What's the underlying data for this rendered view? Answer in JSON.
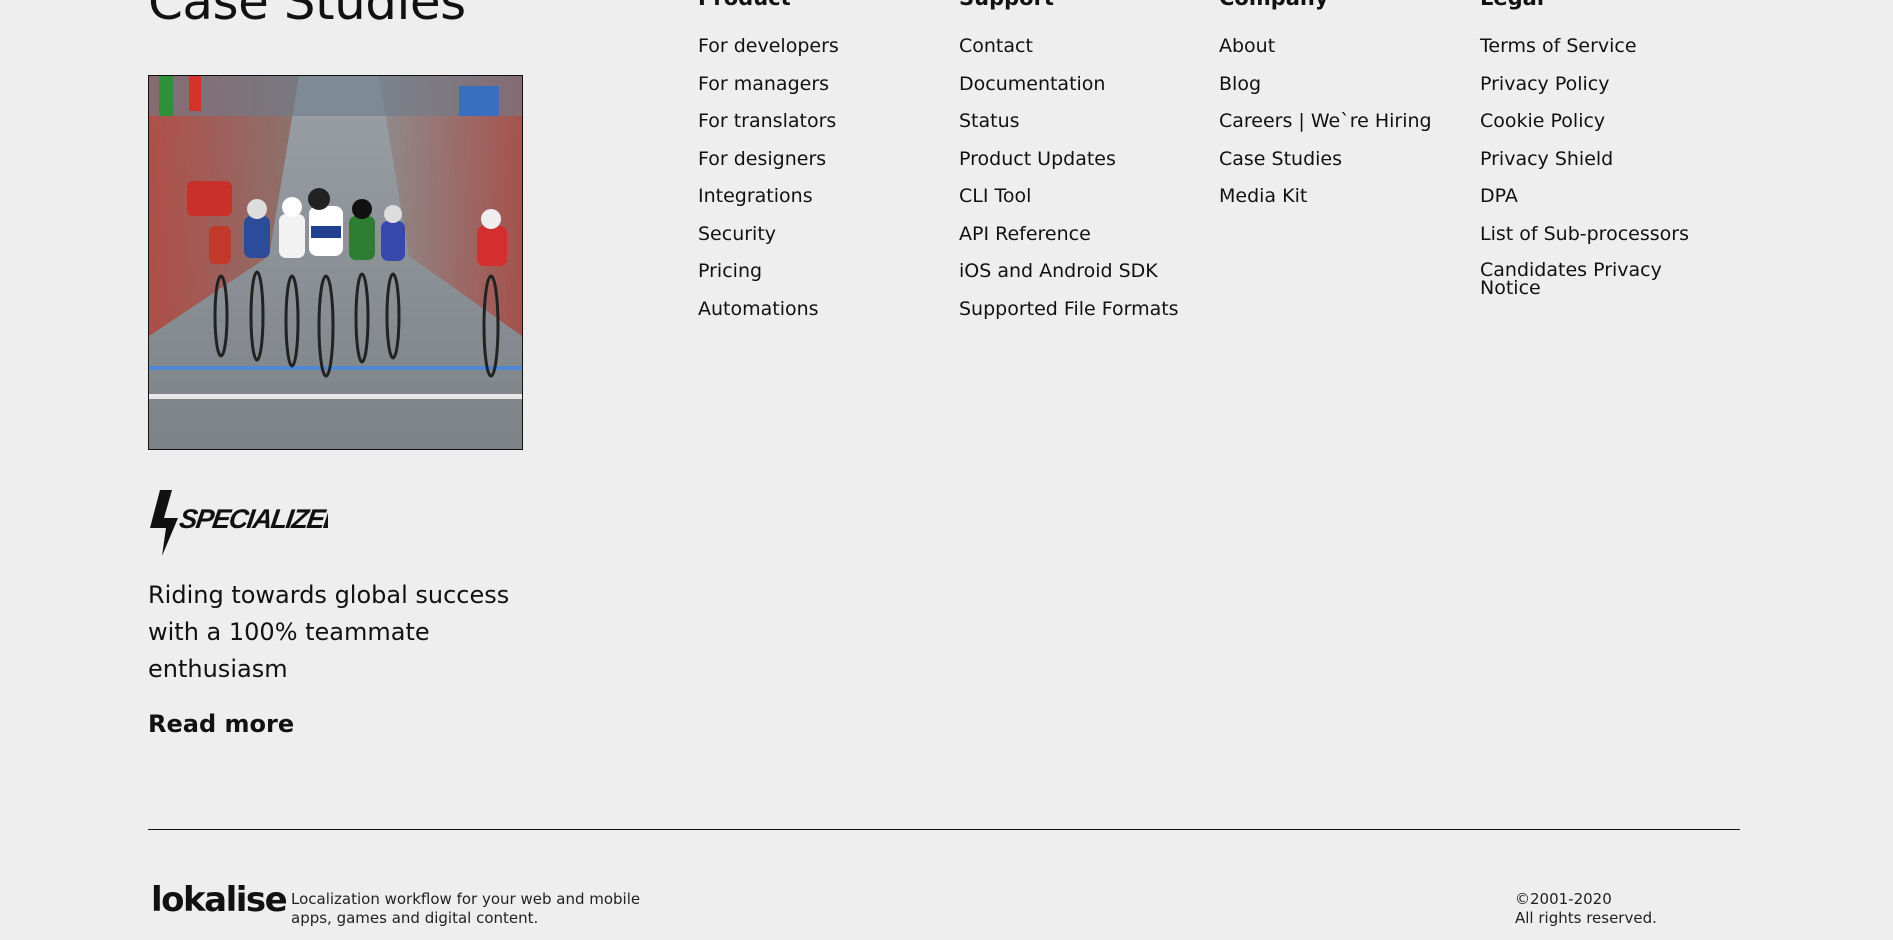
{
  "case_studies": {
    "title": "Case Studies",
    "photo_alt": "Cyclists racing toward the finish line",
    "brand_logo_text": "SPECIALIZED",
    "description": "Riding towards global success with a 100% teammate enthusiasm",
    "read_more": "Read more"
  },
  "footer_nav": {
    "product": {
      "heading": "Product",
      "items": [
        "For developers",
        "For managers",
        "For translators",
        "For designers",
        "Integrations",
        "Security",
        "Pricing",
        "Automations"
      ]
    },
    "support": {
      "heading": "Support",
      "items": [
        "Contact",
        "Documentation",
        "Status",
        "Product Updates",
        "CLI Tool",
        "API Reference",
        "iOS and Android SDK",
        "Supported File Formats"
      ]
    },
    "company": {
      "heading": "Company",
      "items": [
        "About",
        "Blog",
        "Careers | We`re Hiring",
        "Case Studies",
        "Media Kit"
      ]
    },
    "legal": {
      "heading": "Legal",
      "items": [
        "Terms of Service",
        "Privacy Policy",
        "Cookie Policy",
        "Privacy Shield",
        "DPA",
        "List of Sub-processors",
        "Candidates Privacy Notice"
      ]
    }
  },
  "footer": {
    "logo": "lokalise",
    "tagline_line1": "Localization workflow for your web and mobile",
    "tagline_line2": "apps, games and digital content.",
    "copyright_line1": "©2001-2020",
    "copyright_line2": "All rights reserved."
  },
  "colors": {
    "background": "#eeeeee",
    "text": "#111111"
  }
}
